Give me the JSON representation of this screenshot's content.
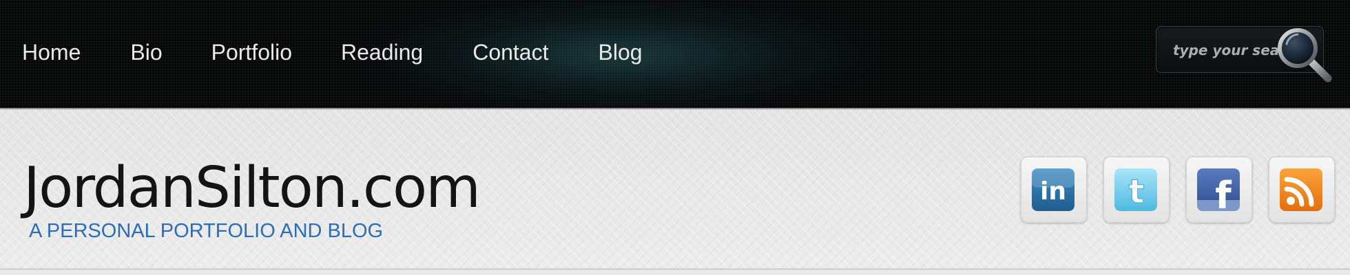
{
  "nav": {
    "items": [
      {
        "label": "Home"
      },
      {
        "label": "Bio"
      },
      {
        "label": "Portfolio"
      },
      {
        "label": "Reading"
      },
      {
        "label": "Contact"
      },
      {
        "label": "Blog"
      }
    ]
  },
  "search": {
    "placeholder": "type your search",
    "value": ""
  },
  "header": {
    "title": "JordanSilton.com",
    "tagline": "A PERSONAL PORTFOLIO AND BLOG"
  },
  "social": {
    "icons": [
      "linkedin-icon",
      "twitter-icon",
      "facebook-icon",
      "rss-icon"
    ],
    "linkedin_text": "in",
    "twitter_text": "t",
    "facebook_text": "f"
  },
  "colors": {
    "nav_background": "#050707",
    "nav_text": "#eaeaea",
    "tagline": "#2b6dbb",
    "title": "#141414",
    "linkedin": "#2a6fa5",
    "twitter": "#7fd3ef",
    "facebook": "#3b5a9a",
    "rss": "#f08a1e"
  }
}
